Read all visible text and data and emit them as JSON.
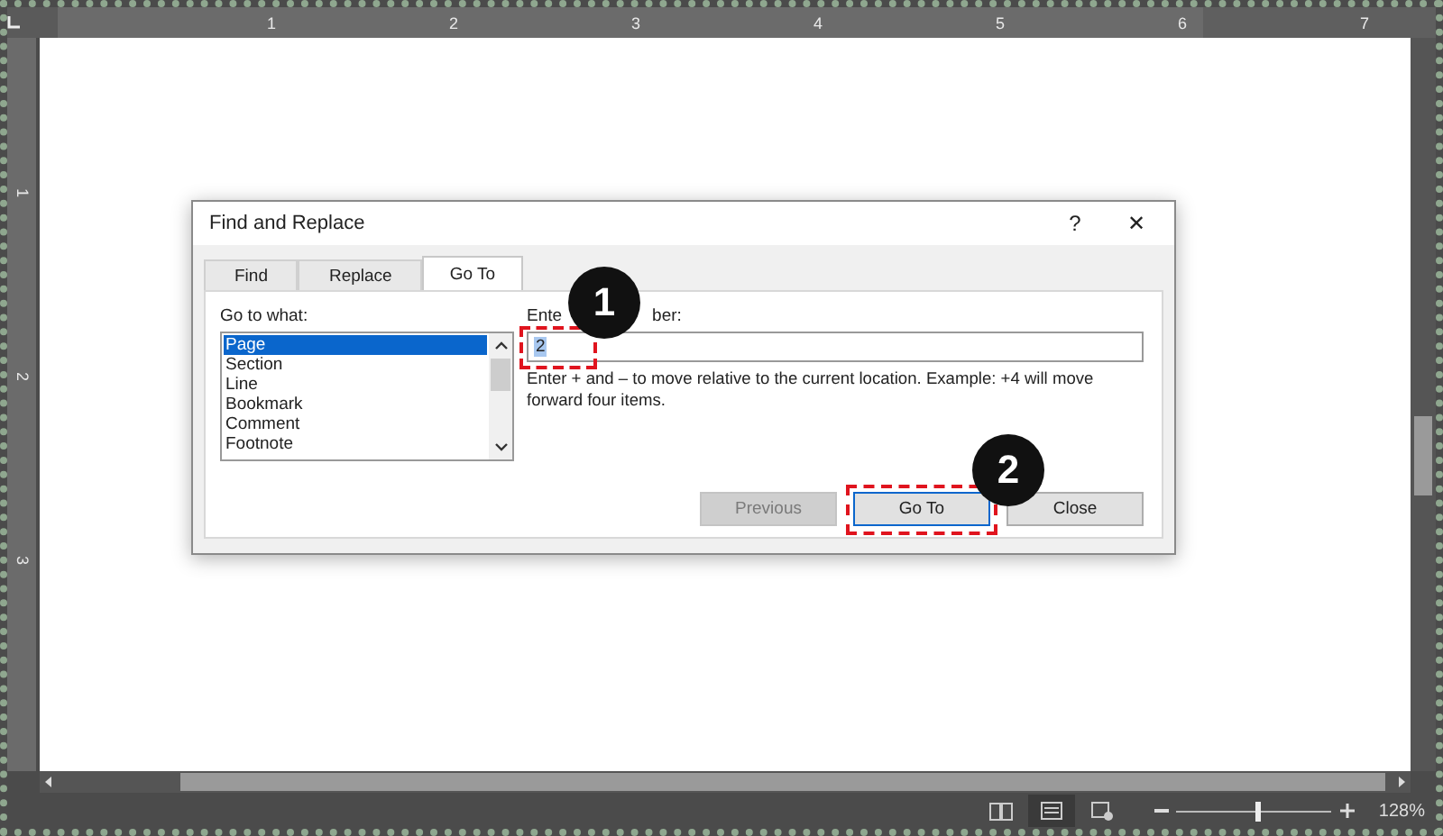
{
  "ruler": {
    "horizontal": [
      "1",
      "2",
      "3",
      "4",
      "5",
      "6",
      "7"
    ],
    "vertical": [
      "1",
      "2",
      "3"
    ]
  },
  "dialog": {
    "title": "Find and Replace",
    "help": "?",
    "close": "✕",
    "tabs": [
      {
        "label": "Find",
        "selected": false
      },
      {
        "label": "Replace",
        "selected": false
      },
      {
        "label": "Go To",
        "selected": true
      }
    ],
    "go_to_what": {
      "label": "Go to what:",
      "items": [
        {
          "label": "Page",
          "selected": true
        },
        {
          "label": "Section",
          "selected": false
        },
        {
          "label": "Line",
          "selected": false
        },
        {
          "label": "Bookmark",
          "selected": false
        },
        {
          "label": "Comment",
          "selected": false
        },
        {
          "label": "Footnote",
          "selected": false
        }
      ]
    },
    "number_label": [
      "Ente",
      "ber:"
    ],
    "number_value": "2",
    "hint": "Enter + and – to move relative to the current location. Example: +4 will move forward four items.",
    "buttons": [
      {
        "label": "Previous",
        "disabled": true,
        "default": false
      },
      {
        "label": "Go To",
        "disabled": false,
        "default": true
      },
      {
        "label": "Close",
        "disabled": false,
        "default": false
      }
    ]
  },
  "annotations": [
    {
      "number": "1"
    },
    {
      "number": "2"
    }
  ],
  "status_bar": {
    "views": [
      {
        "kind": "read",
        "selected": false
      },
      {
        "kind": "print",
        "selected": true
      },
      {
        "kind": "web",
        "selected": false
      }
    ],
    "zoom_slider": {
      "level": 0.52
    },
    "zoom": "128%"
  }
}
